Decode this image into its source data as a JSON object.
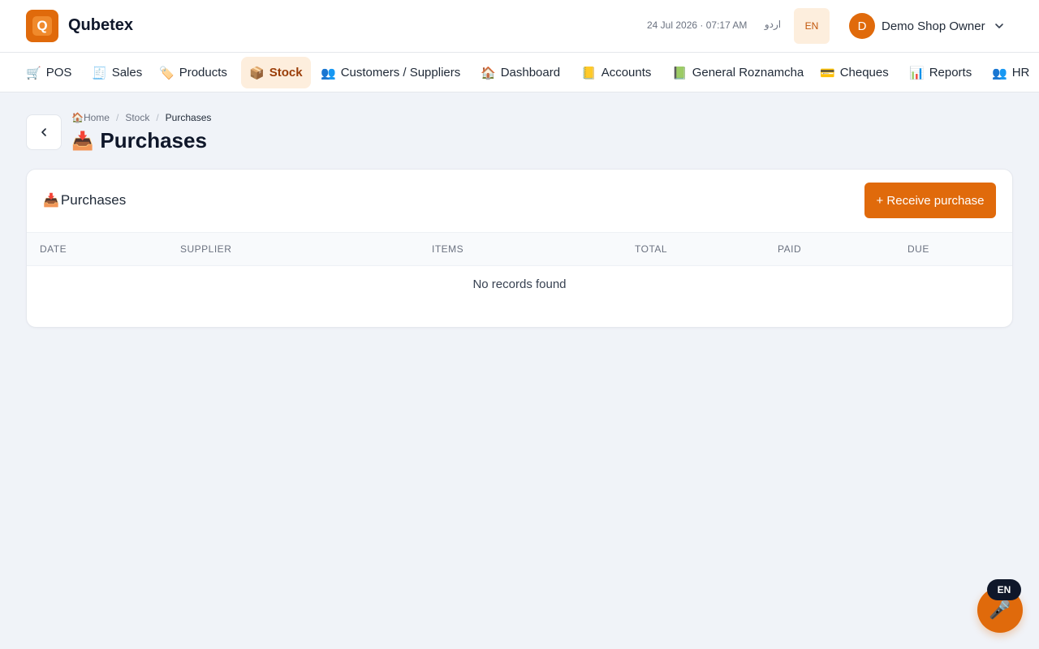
{
  "app": {
    "name": "Qubetex",
    "logo_letter": "Q",
    "accent_color": "#e06a0b"
  },
  "header": {
    "datetime": "24 Jul 2026 · 07:17 AM",
    "lang_urdu": "اردو",
    "lang_en": "EN",
    "user_initial": "D",
    "user_name": "Demo Shop Owner"
  },
  "nav": {
    "items": [
      {
        "icon": "🛒",
        "label": "POS"
      },
      {
        "icon": "🧾",
        "label": "Sales"
      },
      {
        "icon": "🏷️",
        "label": "Products"
      },
      {
        "icon": "📦",
        "label": "Stock",
        "active": true
      },
      {
        "icon": "👥",
        "label": "Customers / Suppliers"
      },
      {
        "icon": "🏠",
        "label": "Dashboard"
      },
      {
        "icon": "📒",
        "label": "Accounts"
      },
      {
        "icon": "📗",
        "label": "General Roznamcha"
      },
      {
        "icon": "💳",
        "label": "Cheques"
      },
      {
        "icon": "📊",
        "label": "Reports"
      },
      {
        "icon": "👥",
        "label": "HR"
      }
    ]
  },
  "breadcrumb": {
    "home_icon": "🏠",
    "home": "Home",
    "stock": "Stock",
    "current": "Purchases"
  },
  "page": {
    "title_icon": "📥",
    "title": "Purchases"
  },
  "card": {
    "title_icon": "📥",
    "title": "Purchases",
    "receive_button": "+ Receive purchase",
    "columns": [
      "DATE",
      "SUPPLIER",
      "ITEMS",
      "TOTAL",
      "PAID",
      "DUE"
    ],
    "empty_text": "No records found"
  },
  "voice": {
    "badge": "EN",
    "icon": "🎤"
  }
}
